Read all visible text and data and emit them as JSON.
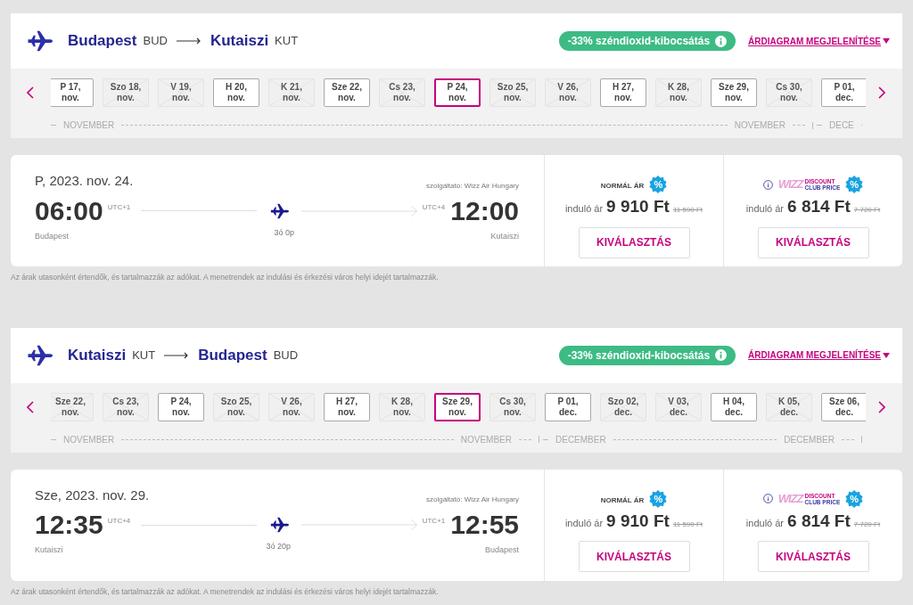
{
  "sections": [
    {
      "route": {
        "from_city": "Budapest",
        "from_code": "BUD",
        "to_city": "Kutaiszi",
        "to_code": "KUT"
      },
      "co2_badge": "-33% széndioxid-kibocsátás",
      "chart_link": "ÁRDIAGRAM MEGJELENÍTÉSE",
      "dates": [
        {
          "day": "P 17,",
          "month": "nov.",
          "available": true,
          "selected": false
        },
        {
          "day": "Szo 18,",
          "month": "nov.",
          "available": false,
          "selected": false
        },
        {
          "day": "V 19,",
          "month": "nov.",
          "available": false,
          "selected": false
        },
        {
          "day": "H 20,",
          "month": "nov.",
          "available": true,
          "selected": false
        },
        {
          "day": "K 21,",
          "month": "nov.",
          "available": false,
          "selected": false
        },
        {
          "day": "Sze 22,",
          "month": "nov.",
          "available": true,
          "selected": false
        },
        {
          "day": "Cs 23,",
          "month": "nov.",
          "available": false,
          "selected": false
        },
        {
          "day": "P 24,",
          "month": "nov.",
          "available": true,
          "selected": true
        },
        {
          "day": "Szo 25,",
          "month": "nov.",
          "available": false,
          "selected": false
        },
        {
          "day": "V 26,",
          "month": "nov.",
          "available": false,
          "selected": false
        },
        {
          "day": "H 27,",
          "month": "nov.",
          "available": true,
          "selected": false
        },
        {
          "day": "K 28,",
          "month": "nov.",
          "available": false,
          "selected": false
        },
        {
          "day": "Sze 29,",
          "month": "nov.",
          "available": true,
          "selected": false
        },
        {
          "day": "Cs 30,",
          "month": "nov.",
          "available": false,
          "selected": false
        },
        {
          "day": "P 01,",
          "month": "dec.",
          "available": true,
          "selected": false
        }
      ],
      "months": [
        {
          "start": "NOVEMBER",
          "end": "NOVEMBER"
        },
        {
          "start": "DECE"
        }
      ],
      "flight": {
        "date": "P, 2023. nov. 24.",
        "operator": "szolgáltató: Wizz Air Hungary",
        "departure_time": "06:00",
        "departure_utc": "UTC+1",
        "departure_city": "Budapest",
        "arrival_utc": "UTC+4",
        "arrival_time": "12:00",
        "arrival_city": "Kutaiszi",
        "duration": "3ó 0p"
      },
      "fares": [
        {
          "kind": "normal",
          "label": "NORMÁL ÁR",
          "badge": "%",
          "from": "induló ár",
          "price": "9 910 Ft",
          "old_price": "11 590 Ft",
          "button": "KIVÁLASZTÁS"
        },
        {
          "kind": "club",
          "brand": "WIZZ",
          "label_lines": [
            "DISCOUNT",
            "CLUB PRICE"
          ],
          "badge": "%",
          "from": "induló ár",
          "price": "6 814 Ft",
          "old_price": "7 720 Ft",
          "button": "KIVÁLASZTÁS"
        }
      ],
      "footnote": "Az árak utasonként értendők, és tartalmazzák az adókat. A menetrendek az indulási és érkezési város helyi idejét tartalmazzák."
    },
    {
      "route": {
        "from_city": "Kutaiszi",
        "from_code": "KUT",
        "to_city": "Budapest",
        "to_code": "BUD"
      },
      "co2_badge": "-33% széndioxid-kibocsátás",
      "chart_link": "ÁRDIAGRAM MEGJELENÍTÉSE",
      "dates": [
        {
          "day": "Sze 22,",
          "month": "nov.",
          "available": false,
          "selected": false
        },
        {
          "day": "Cs 23,",
          "month": "nov.",
          "available": false,
          "selected": false
        },
        {
          "day": "P 24,",
          "month": "nov.",
          "available": true,
          "selected": false
        },
        {
          "day": "Szo 25,",
          "month": "nov.",
          "available": false,
          "selected": false
        },
        {
          "day": "V 26,",
          "month": "nov.",
          "available": false,
          "selected": false
        },
        {
          "day": "H 27,",
          "month": "nov.",
          "available": true,
          "selected": false
        },
        {
          "day": "K 28,",
          "month": "nov.",
          "available": false,
          "selected": false
        },
        {
          "day": "Sze 29,",
          "month": "nov.",
          "available": true,
          "selected": true
        },
        {
          "day": "Cs 30,",
          "month": "nov.",
          "available": false,
          "selected": false
        },
        {
          "day": "P 01,",
          "month": "dec.",
          "available": true,
          "selected": false
        },
        {
          "day": "Szo 02,",
          "month": "dec.",
          "available": false,
          "selected": false
        },
        {
          "day": "V 03,",
          "month": "dec.",
          "available": false,
          "selected": false
        },
        {
          "day": "H 04,",
          "month": "dec.",
          "available": true,
          "selected": false
        },
        {
          "day": "K 05,",
          "month": "dec.",
          "available": false,
          "selected": false
        },
        {
          "day": "Sze 06,",
          "month": "dec.",
          "available": true,
          "selected": false
        }
      ],
      "months": [
        {
          "start": "NOVEMBER",
          "end": "NOVEMBER"
        },
        {
          "start": "DECEMBER",
          "end": "DECEMBER"
        }
      ],
      "flight": {
        "date": "Sze, 2023. nov. 29.",
        "operator": "szolgáltató: Wizz Air Hungary",
        "departure_time": "12:35",
        "departure_utc": "UTC+4",
        "departure_city": "Kutaiszi",
        "arrival_utc": "UTC+1",
        "arrival_time": "12:55",
        "arrival_city": "Budapest",
        "duration": "3ó 20p"
      },
      "fares": [
        {
          "kind": "normal",
          "label": "NORMÁL ÁR",
          "badge": "%",
          "from": "induló ár",
          "price": "9 910 Ft",
          "old_price": "11 590 Ft",
          "button": "KIVÁLASZTÁS"
        },
        {
          "kind": "club",
          "brand": "WIZZ",
          "label_lines": [
            "DISCOUNT",
            "CLUB PRICE"
          ],
          "badge": "%",
          "from": "induló ár",
          "price": "6 814 Ft",
          "old_price": "7 720 Ft",
          "button": "KIVÁLASZTÁS"
        }
      ],
      "footnote": "Az árak utasonként értendők, és tartalmazzák az adókat. A menetrendek az indulási és érkezési város helyi idejét tartalmazzák."
    }
  ]
}
